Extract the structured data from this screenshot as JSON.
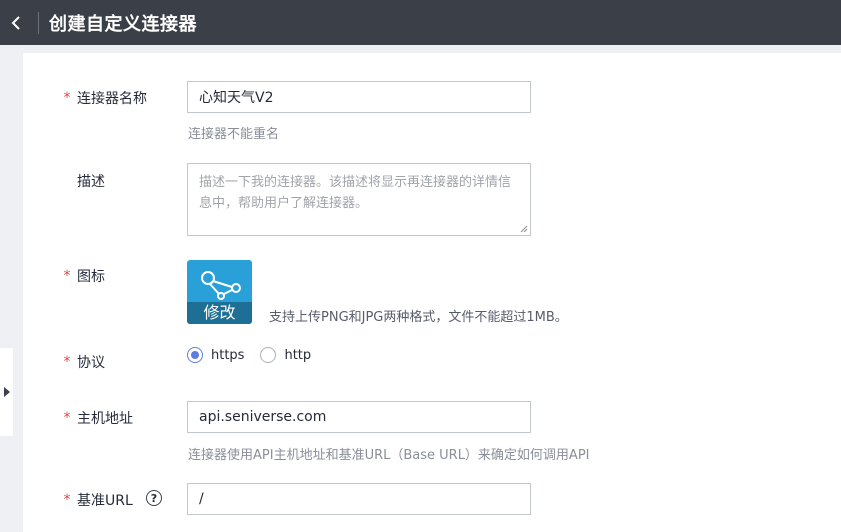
{
  "header": {
    "title": "创建自定义连接器"
  },
  "form": {
    "name": {
      "required_mark": "*",
      "label": "连接器名称",
      "value": "心知天气V2",
      "hint": "连接器不能重名"
    },
    "description": {
      "label": "描述",
      "placeholder": "描述一下我的连接器。该描述将显示再连接器的详情信息中，帮助用户了解连接器。"
    },
    "icon": {
      "required_mark": "*",
      "label": "图标",
      "edit_label": "修改",
      "hint": "支持上传PNG和JPG两种格式，文件不能超过1MB。"
    },
    "protocol": {
      "required_mark": "*",
      "label": "协议",
      "options": [
        {
          "label": "https",
          "checked": true
        },
        {
          "label": "http",
          "checked": false
        }
      ]
    },
    "host": {
      "required_mark": "*",
      "label": "主机地址",
      "value": "api.seniverse.com",
      "hint": "连接器使用API主机地址和基准URL（Base URL）来确定如何调用API"
    },
    "base_url": {
      "required_mark": "*",
      "label": "基准URL",
      "help_glyph": "?",
      "value": "/"
    }
  },
  "colors": {
    "topbar": "#3b4048",
    "accent": "#5e7ce0",
    "required": "#e54545",
    "icon_tile": "#2aa0d9"
  }
}
